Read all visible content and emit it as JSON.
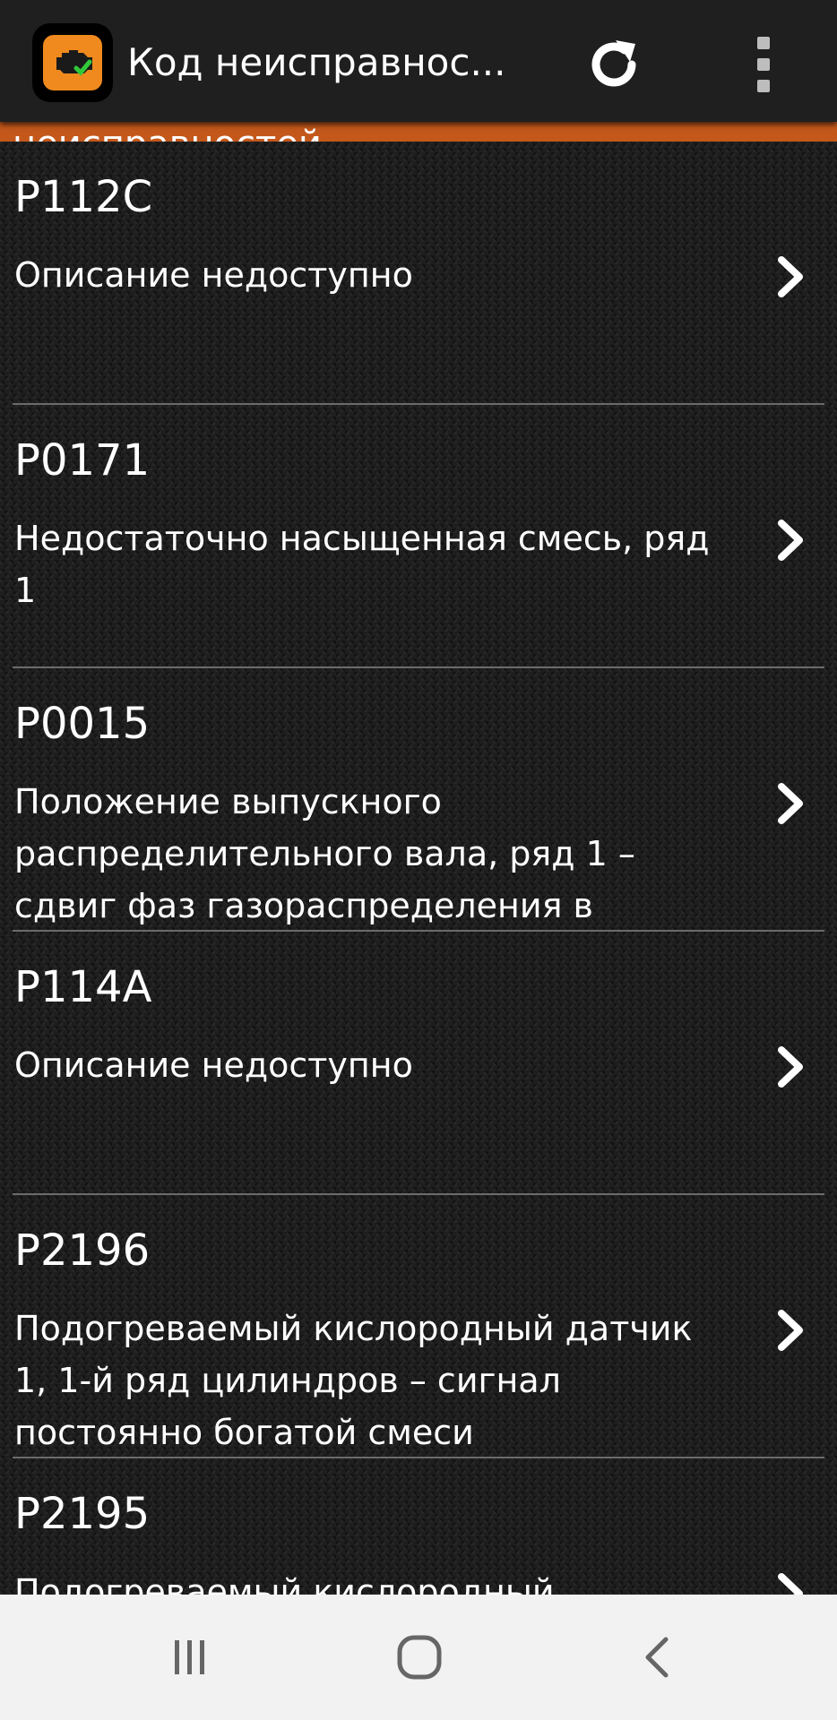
{
  "appbar": {
    "title": "Код неисправнос...",
    "app_icon": "engine-check-icon",
    "refresh_icon": "refresh-icon",
    "menu_icon": "overflow-menu-icon"
  },
  "tab_strip": {
    "partial_text": "неисправностей"
  },
  "items": [
    {
      "code": "P112C",
      "description": "Описание недоступно"
    },
    {
      "code": "P0171",
      "description": "Недостаточно насыщенная смесь, ряд 1"
    },
    {
      "code": "P0015",
      "description": "Положение выпускного распределительного вала, ряд 1 – сдвиг фаз газораспределения в"
    },
    {
      "code": "P114A",
      "description": "Описание недоступно"
    },
    {
      "code": "P2196",
      "description": "Подогреваемый кислородный датчик 1, 1-й ряд цилиндров – сигнал постоянно богатой смеси"
    },
    {
      "code": "P2195",
      "description": "Подогреваемый кислородный"
    }
  ],
  "colors": {
    "accent": "#f08a1e",
    "strip": "#c4581b",
    "appbar": "#1f1f1f",
    "divider": "#6b6b6b"
  },
  "navbar": {
    "recents_icon": "recents-icon",
    "home_icon": "home-icon",
    "back_icon": "back-icon"
  }
}
